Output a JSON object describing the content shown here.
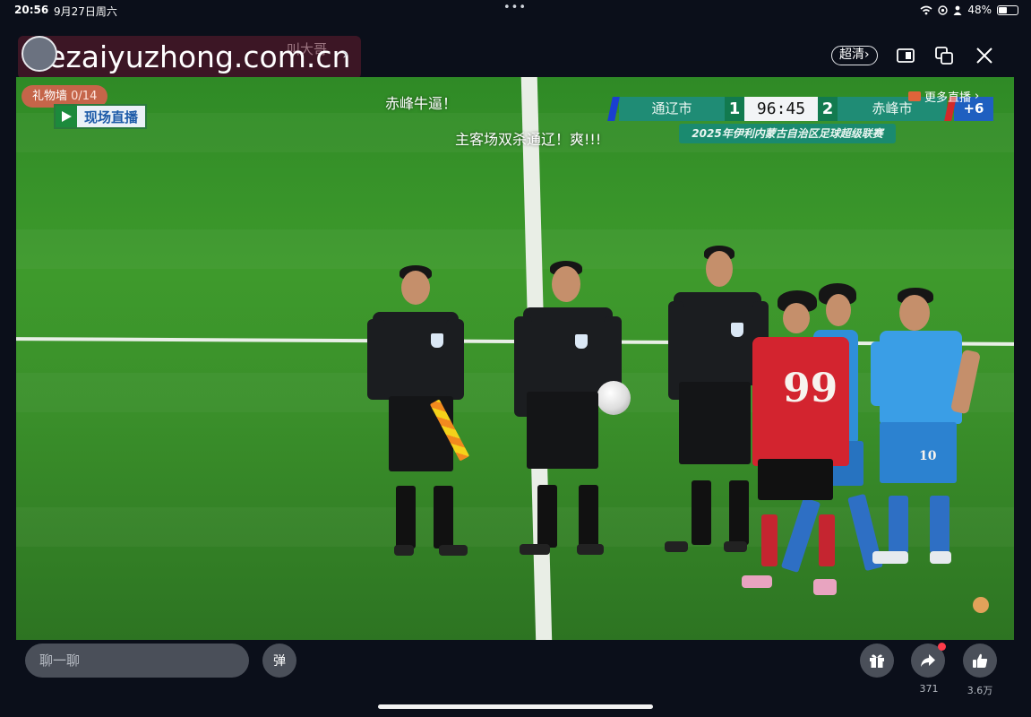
{
  "status_bar": {
    "time": "20:56",
    "date": "9月27日周六",
    "battery": "48%",
    "battery_level": 0.48
  },
  "header": {
    "host_name": "叫大哥",
    "watermark": "lezaiyuzhong.com.cn",
    "quality_button": "超清"
  },
  "overlay": {
    "gift_wall_label": "礼物墙",
    "gift_wall_count": "0/14",
    "live_logo_text": "现场直播",
    "more_live": "更多直播"
  },
  "scoreboard": {
    "home_team": "通辽市",
    "home_score": "1",
    "clock": "96:45",
    "away_score": "2",
    "away_team": "赤峰市",
    "stoppage": "+6",
    "league": "2025年伊利内蒙古自治区足球超级联赛"
  },
  "danmaku": [
    {
      "text": "赤峰牛逼！"
    },
    {
      "text": "主客场双杀通辽！爽!!!"
    }
  ],
  "players": {
    "red_number": "99",
    "blue_number": "10"
  },
  "bottom_bar": {
    "chat_placeholder": "聊一聊",
    "danmu_button": "弹",
    "share_count": "371",
    "like_count": "3.6万"
  },
  "colors": {
    "pitch": "#3e9a2c",
    "scoreboard_green": "#1f8c75",
    "referee_kit": "#1b1d20",
    "home_kit": "#2f8fd8",
    "away_kit": "#d3242f",
    "notification_dot": "#ff3b4a"
  }
}
